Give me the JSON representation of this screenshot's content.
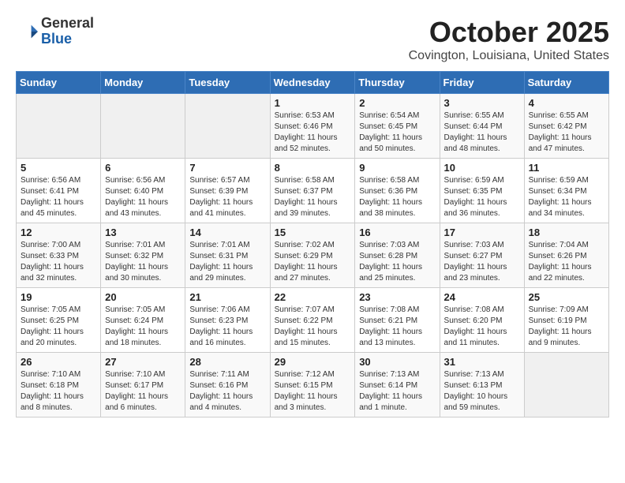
{
  "logo": {
    "general": "General",
    "blue": "Blue"
  },
  "title": "October 2025",
  "subtitle": "Covington, Louisiana, United States",
  "days_of_week": [
    "Sunday",
    "Monday",
    "Tuesday",
    "Wednesday",
    "Thursday",
    "Friday",
    "Saturday"
  ],
  "weeks": [
    [
      {
        "day": "",
        "info": ""
      },
      {
        "day": "",
        "info": ""
      },
      {
        "day": "",
        "info": ""
      },
      {
        "day": "1",
        "info": "Sunrise: 6:53 AM\nSunset: 6:46 PM\nDaylight: 11 hours\nand 52 minutes."
      },
      {
        "day": "2",
        "info": "Sunrise: 6:54 AM\nSunset: 6:45 PM\nDaylight: 11 hours\nand 50 minutes."
      },
      {
        "day": "3",
        "info": "Sunrise: 6:55 AM\nSunset: 6:44 PM\nDaylight: 11 hours\nand 48 minutes."
      },
      {
        "day": "4",
        "info": "Sunrise: 6:55 AM\nSunset: 6:42 PM\nDaylight: 11 hours\nand 47 minutes."
      }
    ],
    [
      {
        "day": "5",
        "info": "Sunrise: 6:56 AM\nSunset: 6:41 PM\nDaylight: 11 hours\nand 45 minutes."
      },
      {
        "day": "6",
        "info": "Sunrise: 6:56 AM\nSunset: 6:40 PM\nDaylight: 11 hours\nand 43 minutes."
      },
      {
        "day": "7",
        "info": "Sunrise: 6:57 AM\nSunset: 6:39 PM\nDaylight: 11 hours\nand 41 minutes."
      },
      {
        "day": "8",
        "info": "Sunrise: 6:58 AM\nSunset: 6:37 PM\nDaylight: 11 hours\nand 39 minutes."
      },
      {
        "day": "9",
        "info": "Sunrise: 6:58 AM\nSunset: 6:36 PM\nDaylight: 11 hours\nand 38 minutes."
      },
      {
        "day": "10",
        "info": "Sunrise: 6:59 AM\nSunset: 6:35 PM\nDaylight: 11 hours\nand 36 minutes."
      },
      {
        "day": "11",
        "info": "Sunrise: 6:59 AM\nSunset: 6:34 PM\nDaylight: 11 hours\nand 34 minutes."
      }
    ],
    [
      {
        "day": "12",
        "info": "Sunrise: 7:00 AM\nSunset: 6:33 PM\nDaylight: 11 hours\nand 32 minutes."
      },
      {
        "day": "13",
        "info": "Sunrise: 7:01 AM\nSunset: 6:32 PM\nDaylight: 11 hours\nand 30 minutes."
      },
      {
        "day": "14",
        "info": "Sunrise: 7:01 AM\nSunset: 6:31 PM\nDaylight: 11 hours\nand 29 minutes."
      },
      {
        "day": "15",
        "info": "Sunrise: 7:02 AM\nSunset: 6:29 PM\nDaylight: 11 hours\nand 27 minutes."
      },
      {
        "day": "16",
        "info": "Sunrise: 7:03 AM\nSunset: 6:28 PM\nDaylight: 11 hours\nand 25 minutes."
      },
      {
        "day": "17",
        "info": "Sunrise: 7:03 AM\nSunset: 6:27 PM\nDaylight: 11 hours\nand 23 minutes."
      },
      {
        "day": "18",
        "info": "Sunrise: 7:04 AM\nSunset: 6:26 PM\nDaylight: 11 hours\nand 22 minutes."
      }
    ],
    [
      {
        "day": "19",
        "info": "Sunrise: 7:05 AM\nSunset: 6:25 PM\nDaylight: 11 hours\nand 20 minutes."
      },
      {
        "day": "20",
        "info": "Sunrise: 7:05 AM\nSunset: 6:24 PM\nDaylight: 11 hours\nand 18 minutes."
      },
      {
        "day": "21",
        "info": "Sunrise: 7:06 AM\nSunset: 6:23 PM\nDaylight: 11 hours\nand 16 minutes."
      },
      {
        "day": "22",
        "info": "Sunrise: 7:07 AM\nSunset: 6:22 PM\nDaylight: 11 hours\nand 15 minutes."
      },
      {
        "day": "23",
        "info": "Sunrise: 7:08 AM\nSunset: 6:21 PM\nDaylight: 11 hours\nand 13 minutes."
      },
      {
        "day": "24",
        "info": "Sunrise: 7:08 AM\nSunset: 6:20 PM\nDaylight: 11 hours\nand 11 minutes."
      },
      {
        "day": "25",
        "info": "Sunrise: 7:09 AM\nSunset: 6:19 PM\nDaylight: 11 hours\nand 9 minutes."
      }
    ],
    [
      {
        "day": "26",
        "info": "Sunrise: 7:10 AM\nSunset: 6:18 PM\nDaylight: 11 hours\nand 8 minutes."
      },
      {
        "day": "27",
        "info": "Sunrise: 7:10 AM\nSunset: 6:17 PM\nDaylight: 11 hours\nand 6 minutes."
      },
      {
        "day": "28",
        "info": "Sunrise: 7:11 AM\nSunset: 6:16 PM\nDaylight: 11 hours\nand 4 minutes."
      },
      {
        "day": "29",
        "info": "Sunrise: 7:12 AM\nSunset: 6:15 PM\nDaylight: 11 hours\nand 3 minutes."
      },
      {
        "day": "30",
        "info": "Sunrise: 7:13 AM\nSunset: 6:14 PM\nDaylight: 11 hours\nand 1 minute."
      },
      {
        "day": "31",
        "info": "Sunrise: 7:13 AM\nSunset: 6:13 PM\nDaylight: 10 hours\nand 59 minutes."
      },
      {
        "day": "",
        "info": ""
      }
    ]
  ]
}
